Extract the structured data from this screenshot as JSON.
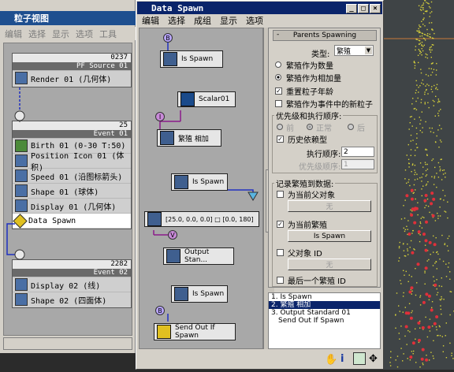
{
  "back_window": {
    "title": "粒子视图",
    "menu": [
      "编辑",
      "选择",
      "显示",
      "选项",
      "工具"
    ],
    "events": [
      {
        "count": "0237",
        "name": "PF Source 01",
        "ops": [
          {
            "label": "Render 01 (几何体)",
            "icon": "teapot-icon"
          }
        ]
      },
      {
        "count": "25",
        "name": "Event 01",
        "ops": [
          {
            "label": "Birth 01 (0-30 T:50)",
            "icon": "birth-icon"
          },
          {
            "label": "Position Icon 01 (体积)",
            "icon": "position-icon"
          },
          {
            "label": "Speed 01 (沿图标箭头)",
            "icon": "speed-icon"
          },
          {
            "label": "Shape 01 (球体)",
            "icon": "shape-icon"
          },
          {
            "label": "Display 01 (几何体)",
            "icon": "display-icon"
          },
          {
            "label": "Data Spawn",
            "icon": "data-spawn-icon"
          }
        ]
      },
      {
        "count": "2282",
        "name": "Event 02",
        "ops": [
          {
            "label": "Display 02 (线)",
            "icon": "display-icon"
          },
          {
            "label": "Shape 02 (四面体)",
            "icon": "shape-icon"
          }
        ]
      }
    ]
  },
  "window": {
    "title": "Data Spawn",
    "menu": [
      "编辑",
      "选择",
      "成组",
      "显示",
      "选项"
    ],
    "controls": {
      "minimize": "_",
      "maximize": "□",
      "close": "×"
    }
  },
  "flow": {
    "nodes": [
      {
        "label": "Is Spawn",
        "port": "B"
      },
      {
        "label": "Scalar01"
      },
      {
        "label": "繁殖 相加",
        "port": "I"
      },
      {
        "label": "Is Spawn"
      },
      {
        "label": "[25.0, 0.0, 0.0] □ [0.0, 180]"
      },
      {
        "label": "Output Stan...",
        "port": "V"
      },
      {
        "label": "Is Spawn"
      },
      {
        "label": "Send Out If Spawn",
        "port": "B"
      }
    ]
  },
  "rollout": {
    "header": "Parents Spawning",
    "minus": "-",
    "type_label": "类型:",
    "type_value": "繁殖",
    "radio_count": "繁殖作为数量",
    "radio_add": "繁殖作为相加量",
    "check_reset_age": "重置粒子年龄",
    "check_new_particle": "繁殖作为事件中的新粒子",
    "priority_group": "优先级和执行顺序:",
    "priority_options": [
      "前",
      "正常",
      "后"
    ],
    "check_history": "历史依赖型",
    "exec_order_label": "执行顺序:",
    "exec_order_value": "2",
    "priority_label": "优先级顺序:",
    "priority_value": "1",
    "record_group": "记录繁殖到数据:",
    "check_current_parent": "为当前父对象",
    "none_label": "无",
    "check_current_spawn": "为当前繁殖",
    "is_spawn_button": "Is Spawn",
    "check_parent_id": "父对象 ID",
    "check_last_spawn": "最后一个繁殖 ID"
  },
  "list": {
    "items": [
      "1. Is Spawn",
      "2. 繁殖 相加",
      "3. Output Standard 01",
      "Send Out If Spawn"
    ],
    "selected": 1
  },
  "colors": {
    "title_active": "#0a246a",
    "title_inactive": "#1e4f8f",
    "panel": "#d4d0c8",
    "canvas": "#a8a8a8",
    "particles": "#d8d23a",
    "particles_red": "#e0303a"
  }
}
